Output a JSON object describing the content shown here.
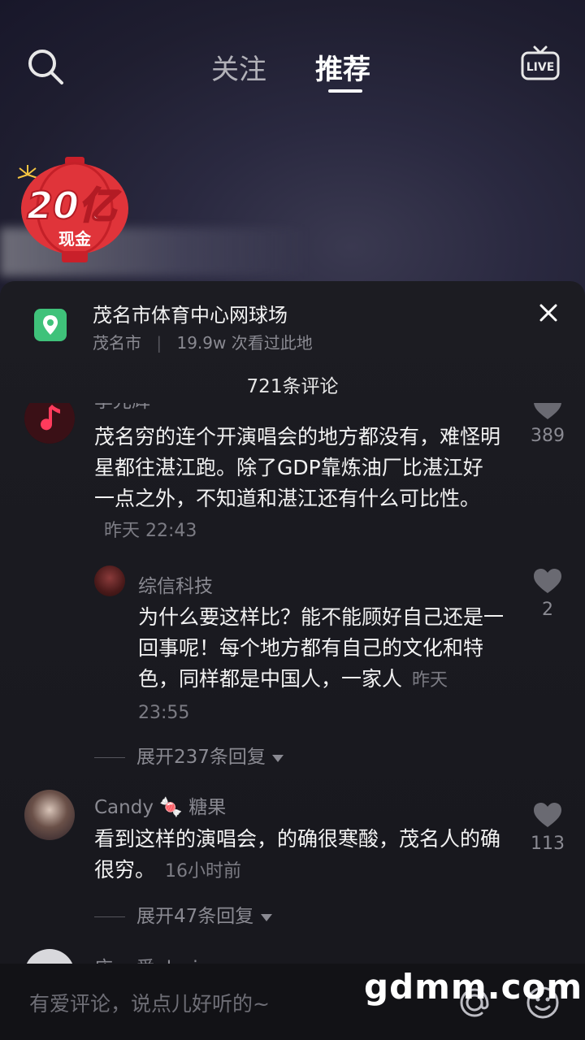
{
  "top_nav": {
    "tab_follow": "关注",
    "tab_recommend": "推荐",
    "live_label": "LIVE"
  },
  "promo": {
    "amount": "20亿",
    "cash_label": "现金"
  },
  "location": {
    "title": "茂名市体育中心网球场",
    "city": "茂名市",
    "separator": "|",
    "views": "19.9w 次看过此地"
  },
  "comments_header": "721条评论",
  "comments": [
    {
      "name": "李光辉",
      "text": "茂名穷的连个开演唱会的地方都没有，难怪明星都往湛江跑。除了GDP靠炼油厂比湛江好一点之外，不知道和湛江还有什么可比性。",
      "time": "昨天 22:43",
      "likes": "389"
    },
    {
      "name": "综信科技",
      "text": "为什么要这样比？能不能顾好自己还是一回事呢！每个地方都有自己的文化和特色，同样都是中国人，一家人",
      "time": "昨天 23:55",
      "likes": "2"
    },
    {
      "name": "Candy 🍬 糖果",
      "text": "看到这样的演唱会，的确很寒酸，茂名人的确很穷。",
      "time": "16小时前",
      "likes": "113"
    },
    {
      "name": "庄go爱alesium"
    }
  ],
  "expand_replies": [
    "展开237条回复",
    "展开47条回复"
  ],
  "input": {
    "placeholder": "有爱评论，说点儿好听的~"
  },
  "watermark": "gdmm.com",
  "colors": {
    "sheet_bg": "#1c1c22",
    "location_icon": "#3fc27a",
    "muted_text": "#8a8a92"
  }
}
